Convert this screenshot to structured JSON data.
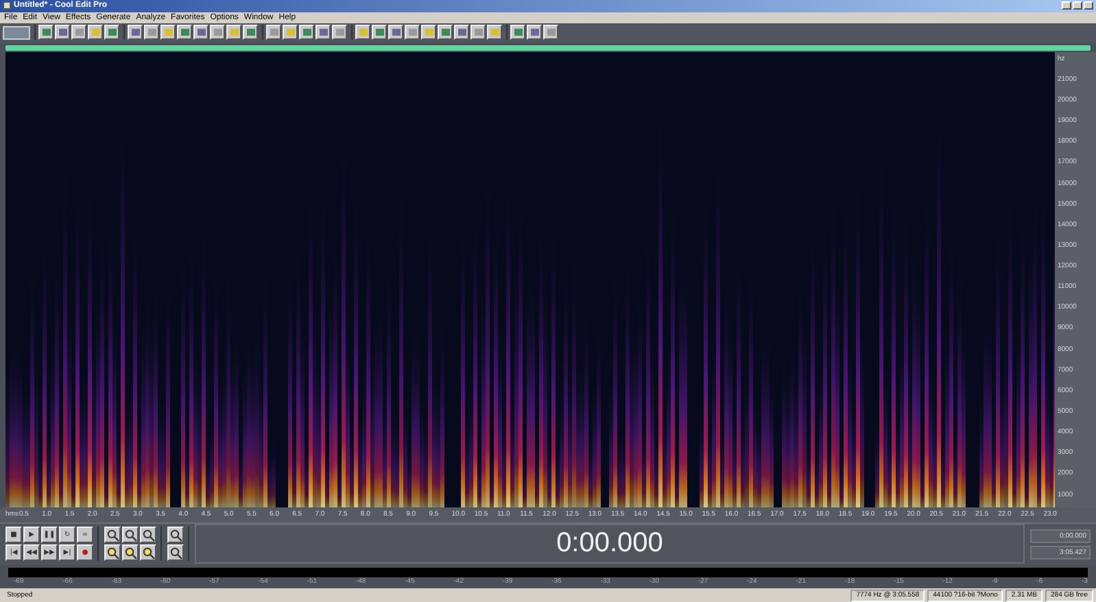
{
  "window": {
    "title": "Untitled* - Cool Edit Pro"
  },
  "menu": [
    "File",
    "Edit",
    "View",
    "Effects",
    "Generate",
    "Analyze",
    "Favorites",
    "Options",
    "Window",
    "Help"
  ],
  "frequency_axis": {
    "labels": [
      "hz",
      "21000",
      "20000",
      "19000",
      "18000",
      "17000",
      "16000",
      "15000",
      "14000",
      "13000",
      "12000",
      "11000",
      "10000",
      "9000",
      "8000",
      "7000",
      "6000",
      "5000",
      "4000",
      "3000",
      "2000",
      "1000"
    ]
  },
  "time_ruler": {
    "unit": "hms",
    "labels": [
      "0.5",
      "1.0",
      "1.5",
      "2.0",
      "2.5",
      "3.0",
      "3.5",
      "4.0",
      "4.5",
      "5.0",
      "5.5",
      "6.0",
      "6.5",
      "7.0",
      "7.5",
      "8.0",
      "8.5",
      "9.0",
      "9.5",
      "10.0",
      "10.5",
      "11.0",
      "11.5",
      "12.0",
      "12.5",
      "13.0",
      "13.5",
      "14.0",
      "14.5",
      "15.0",
      "15.5",
      "16.0",
      "16.5",
      "17.0",
      "17.5",
      "18.0",
      "18.5",
      "19.0",
      "19.5",
      "20.0",
      "20.5",
      "21.0",
      "21.5",
      "22.0",
      "22.5",
      "23.0"
    ]
  },
  "transport": {
    "rows": [
      [
        "■",
        "▶",
        "❚❚",
        "↻",
        "∞"
      ],
      [
        "|◀",
        "◀◀",
        "▶▶",
        "▶|",
        "●"
      ]
    ]
  },
  "time_display": "0:00.000",
  "selection": {
    "begin": "0:00.000",
    "end": "3:05.427"
  },
  "level_meter": {
    "labels": [
      "-69",
      "-66",
      "-63",
      "-60",
      "-57",
      "-54",
      "-51",
      "-48",
      "-45",
      "-42",
      "-39",
      "-36",
      "-33",
      "-30",
      "-27",
      "-24",
      "-21",
      "-18",
      "-15",
      "-12",
      "-9",
      "-6",
      "-3"
    ]
  },
  "status_bar": {
    "state": "Stopped",
    "cursor": "7774 Hz @ 3:05.558",
    "format": "44100 ?16-bit ?Mono",
    "size": "2.31 MB",
    "free": "284 GB free"
  }
}
